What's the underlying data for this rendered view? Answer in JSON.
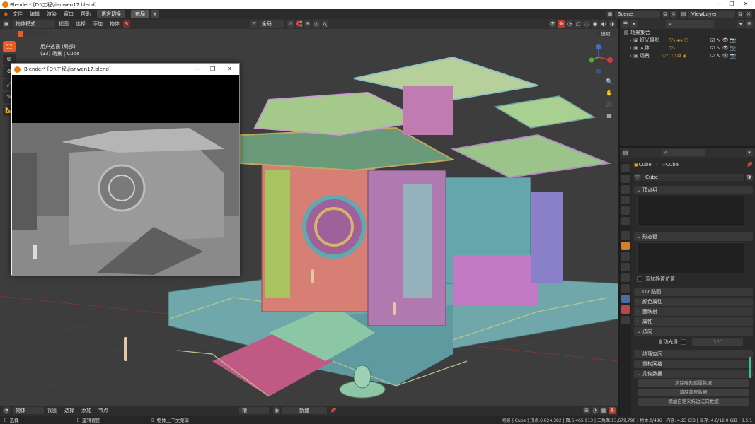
{
  "window": {
    "title": "Blender* [D:\\工程\\jianwen17.blend]",
    "minimize": "—",
    "maximize": "❐",
    "close": "✕"
  },
  "menubar": {
    "items": [
      "文件",
      "编辑",
      "渲染",
      "窗口",
      "帮助"
    ],
    "lang_switch": "语言切换",
    "workspace_tab": "布局",
    "add_tab": "+",
    "scene_label": "Scene",
    "viewlayer_label": "ViewLayer"
  },
  "viewport_header": {
    "mode": "物体模式",
    "menus": [
      "视图",
      "选择",
      "添加",
      "物体"
    ],
    "transform": "全局",
    "options": "选项"
  },
  "viewport": {
    "view_name": "用户透视 (局部)",
    "collection_info": "(33) 场景 | Cube"
  },
  "render_window": {
    "title": "Blender* [D:\\工程\\jianwen17.blend]"
  },
  "outliner": {
    "root": "场景集合",
    "items": [
      "灯光摄影",
      "人体",
      "场景"
    ]
  },
  "properties": {
    "breadcrumb_object": "Cube",
    "breadcrumb_mesh": "Cube",
    "mesh_name": "Cube",
    "panels": {
      "vertex_groups": "顶点组",
      "shape_keys": "形态键",
      "rest_position": "添加静置位置",
      "uv_maps": "UV 贴图",
      "color_attributes": "颜色属性",
      "face_maps": "面映射",
      "attributes": "属性",
      "normals": "法向",
      "auto_smooth": "自动光滑",
      "auto_smooth_angle": "30°",
      "texture_space": "纹理空间",
      "remesh": "重构网格",
      "geometry_data": "几何数据",
      "clear_sculpt_mask": "清除雕刻遮罩数据",
      "clear_skin_data": "清除蒙皮数据",
      "add_custom_split_normals": "添加自定义拆边法向数据"
    }
  },
  "bottom_header": {
    "editor": "物体",
    "menus": [
      "视图",
      "选择",
      "添加",
      "节点"
    ],
    "slot": "槽",
    "new_button": "新建"
  },
  "statusbar": {
    "select": "选择",
    "rotate_view": "旋转视图",
    "context_menu": "物体上下文菜单",
    "stats": "场景 | Cube | 顶点:6,824,382 | 面:6,465,913 | 三角面:13,679,790 | 物体:0/486 | 内存: 4.23 GiB | 显存: 4.6/12.0 GiB | 3.5.1"
  },
  "colors": {
    "accent": "#e85d1f",
    "panel_bg": "#2a2a2a",
    "viewport_bg": "#3d3d3d"
  }
}
